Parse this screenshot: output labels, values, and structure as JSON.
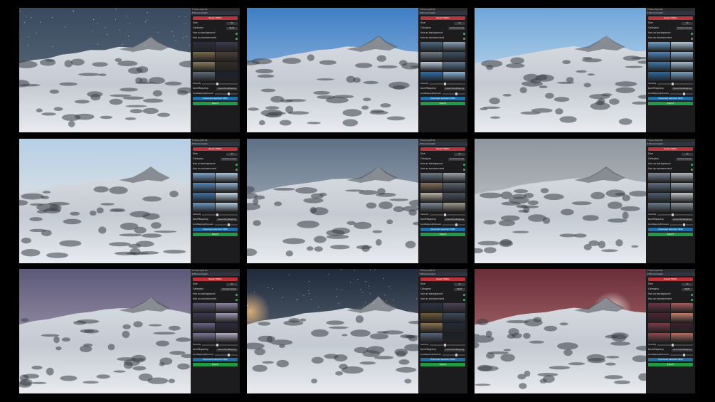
{
  "panel": {
    "window_title": "Three.Light.GL",
    "section_title": "Environment",
    "reset_label": "Reset HDRIs",
    "size_label": "Size",
    "category_label": "Category",
    "use_background_label": "Use as background",
    "use_environment_label": "Use as environment",
    "intensity_label": "Intensity",
    "tone_mapping_label": "toneMapping",
    "tone_mapping_value": "CineonToneMapping",
    "exposure_label": "toneMappingExposure",
    "download_label": "Download selected HDRI",
    "export_label": "Export"
  },
  "variants": [
    {
      "sky_top": "#394a5f",
      "sky_bottom": "#6b7888",
      "stars": true,
      "glow": "",
      "size": "8k",
      "category": "Night",
      "thumbs": [
        "#2a2f3c",
        "#3b3b4e",
        "#7b6a44",
        "#4b4035",
        "#8a7a5a",
        "#332c25",
        "#5b6b7a",
        "#1b2230"
      ]
    },
    {
      "sky_top": "#3f7fc5",
      "sky_bottom": "#b9d2e8",
      "stars": false,
      "glow": "",
      "size": "4k",
      "category": "Sunrise-Sunset",
      "thumbs": [
        "#4c6a86",
        "#8aa1b7",
        "#6f7f89",
        "#3d5168",
        "#b7c8d8",
        "#5c7a94",
        "#2f6fae",
        "#88b4d8"
      ]
    },
    {
      "sky_top": "#6ea6d8",
      "sky_bottom": "#e9f1f7",
      "stars": false,
      "glow": "",
      "size": "4k",
      "category": "Sunrise-Sunset",
      "thumbs": [
        "#6aa2cc",
        "#b0c8dc",
        "#4c86bb",
        "#8fb3d3",
        "#3d78b0",
        "#a5bed4",
        "#2c6aa3",
        "#7aa2c5"
      ]
    },
    {
      "sky_top": "#b6cfe6",
      "sky_bottom": "#f3ede0",
      "stars": false,
      "glow": "",
      "size": "4k",
      "category": "Sunrise-Sunset",
      "thumbs": [
        "#7ca6cf",
        "#a9c5df",
        "#5789ba",
        "#92b4d4",
        "#3e74ab",
        "#c7d8e8",
        "#6b97c2",
        "#b5cde2"
      ]
    },
    {
      "sky_top": "#5f7086",
      "sky_bottom": "#c3cbd2",
      "stars": false,
      "glow": "",
      "size": "2k",
      "category": "Sunrise-Sunset",
      "thumbs": [
        "#6f7c88",
        "#9aa5ae",
        "#83715c",
        "#5a6772",
        "#b5b1a4",
        "#48525c",
        "#7f8b96",
        "#a29a8c"
      ]
    },
    {
      "sky_top": "#8f969e",
      "sky_bottom": "#d8dadc",
      "stars": false,
      "glow": "",
      "size": "4k",
      "category": "Sunrise-Sunset",
      "thumbs": [
        "#7a8796",
        "#b0b8c0",
        "#5f6f82",
        "#9ba6b1",
        "#4d5e70",
        "#c2c8cd",
        "#6a7b8c",
        "#8e99a3"
      ]
    },
    {
      "sky_top": "#5b5878",
      "sky_bottom": "#c7b9cc",
      "stars": false,
      "glow": "",
      "size": "4k",
      "category": "Sunrise-Sunset",
      "thumbs": [
        "#5a5670",
        "#8c84a0",
        "#3f3b52",
        "#a29ab4",
        "#6b6585",
        "#2c2a3c",
        "#7c7696",
        "#b6aec6"
      ]
    },
    {
      "sky_top": "#1f2a3a",
      "sky_bottom": "#7b8796",
      "stars": true,
      "glow": "#e0b27a",
      "size": "4k",
      "category": "Night",
      "thumbs": [
        "#2b3344",
        "#4a4255",
        "#6c5a3d",
        "#3c4a5e",
        "#8b7452",
        "#232b38",
        "#56647a",
        "#1a212c"
      ]
    },
    {
      "sky_top": "#6a2e3a",
      "sky_bottom": "#c98a87",
      "stars": false,
      "glow": "#fff5e8",
      "size": "4k",
      "category": "Night",
      "thumbs": [
        "#6b3442",
        "#a45d5c",
        "#4d2633",
        "#c27d6e",
        "#7c3c47",
        "#3c1f2a",
        "#8e4a50",
        "#b56f66"
      ]
    }
  ]
}
